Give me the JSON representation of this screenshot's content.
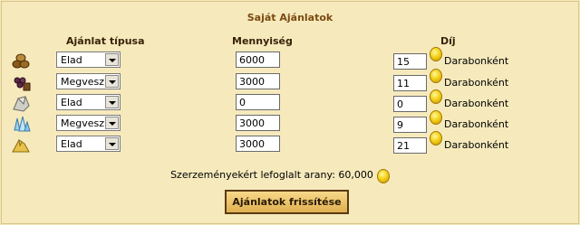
{
  "title": "Saját Ajánlatok",
  "headers": {
    "type": "Ajánlat típusa",
    "quantity": "Mennyiség",
    "price": "Díj"
  },
  "rows": [
    {
      "resource_icon": "wood-icon",
      "type": "Elad",
      "quantity": "6000",
      "price": "15",
      "unit": "Darabonként"
    },
    {
      "resource_icon": "wine-icon",
      "type": "Megvesz",
      "quantity": "3000",
      "price": "11",
      "unit": "Darabonként"
    },
    {
      "resource_icon": "marble-icon",
      "type": "Elad",
      "quantity": "0",
      "price": "0",
      "unit": "Darabonként"
    },
    {
      "resource_icon": "crystal-icon",
      "type": "Megvesz",
      "quantity": "3000",
      "price": "9",
      "unit": "Darabonként"
    },
    {
      "resource_icon": "sulfur-icon",
      "type": "Elad",
      "quantity": "3000",
      "price": "21",
      "unit": "Darabonként"
    }
  ],
  "summary": "Szerzeményekért lefoglalt arany: 60,000",
  "button_label": "Ajánlatok frissítése",
  "colors": {
    "background": "#f6eabd",
    "title": "#7a4a10",
    "button": "#e0b04f",
    "gold": "#f4d21a"
  }
}
